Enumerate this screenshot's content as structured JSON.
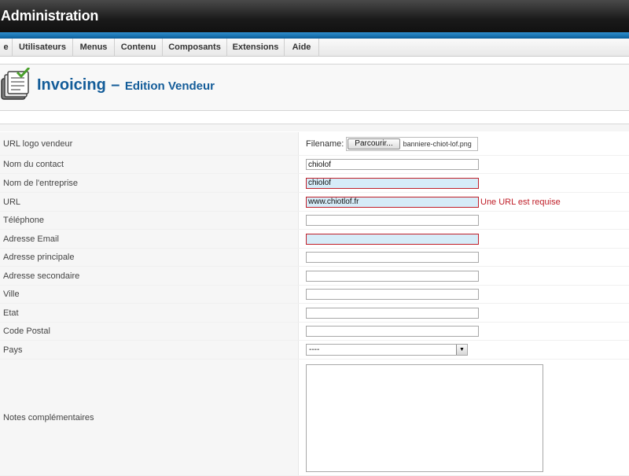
{
  "window": {
    "title": "Administration"
  },
  "nav": {
    "items": [
      {
        "label": "e"
      },
      {
        "label": "Utilisateurs"
      },
      {
        "label": "Menus"
      },
      {
        "label": "Contenu"
      },
      {
        "label": "Composants"
      },
      {
        "label": "Extensions"
      },
      {
        "label": "Aide"
      }
    ]
  },
  "header": {
    "title": "Invoicing",
    "separator": "–",
    "subtitle": "Edition Vendeur",
    "icon": "invoice-icon"
  },
  "colors": {
    "header_blue": "#135c99",
    "error_red": "#c0202a",
    "invalid_bg": "#d6ecf8"
  },
  "form": {
    "logo": {
      "label": "URL logo vendeur",
      "filename_label": "Filename:",
      "browse_label": "Parcourir...",
      "file_value": "banniere-chiot-lof.png"
    },
    "contact": {
      "label": "Nom du contact",
      "value": "chiolof"
    },
    "company": {
      "label": "Nom de l'entreprise",
      "value": "chiolof"
    },
    "url": {
      "label": "URL",
      "value": "www.chiotlof.fr",
      "error": "Une URL est requise"
    },
    "phone": {
      "label": "Téléphone",
      "value": ""
    },
    "email": {
      "label": "Adresse Email",
      "value": ""
    },
    "address1": {
      "label": "Adresse principale",
      "value": ""
    },
    "address2": {
      "label": "Adresse secondaire",
      "value": ""
    },
    "city": {
      "label": "Ville",
      "value": ""
    },
    "state": {
      "label": "Etat",
      "value": ""
    },
    "zip": {
      "label": "Code Postal",
      "value": ""
    },
    "country": {
      "label": "Pays",
      "selected": "----"
    },
    "notes": {
      "label": "Notes complémentaires",
      "value": ""
    }
  }
}
